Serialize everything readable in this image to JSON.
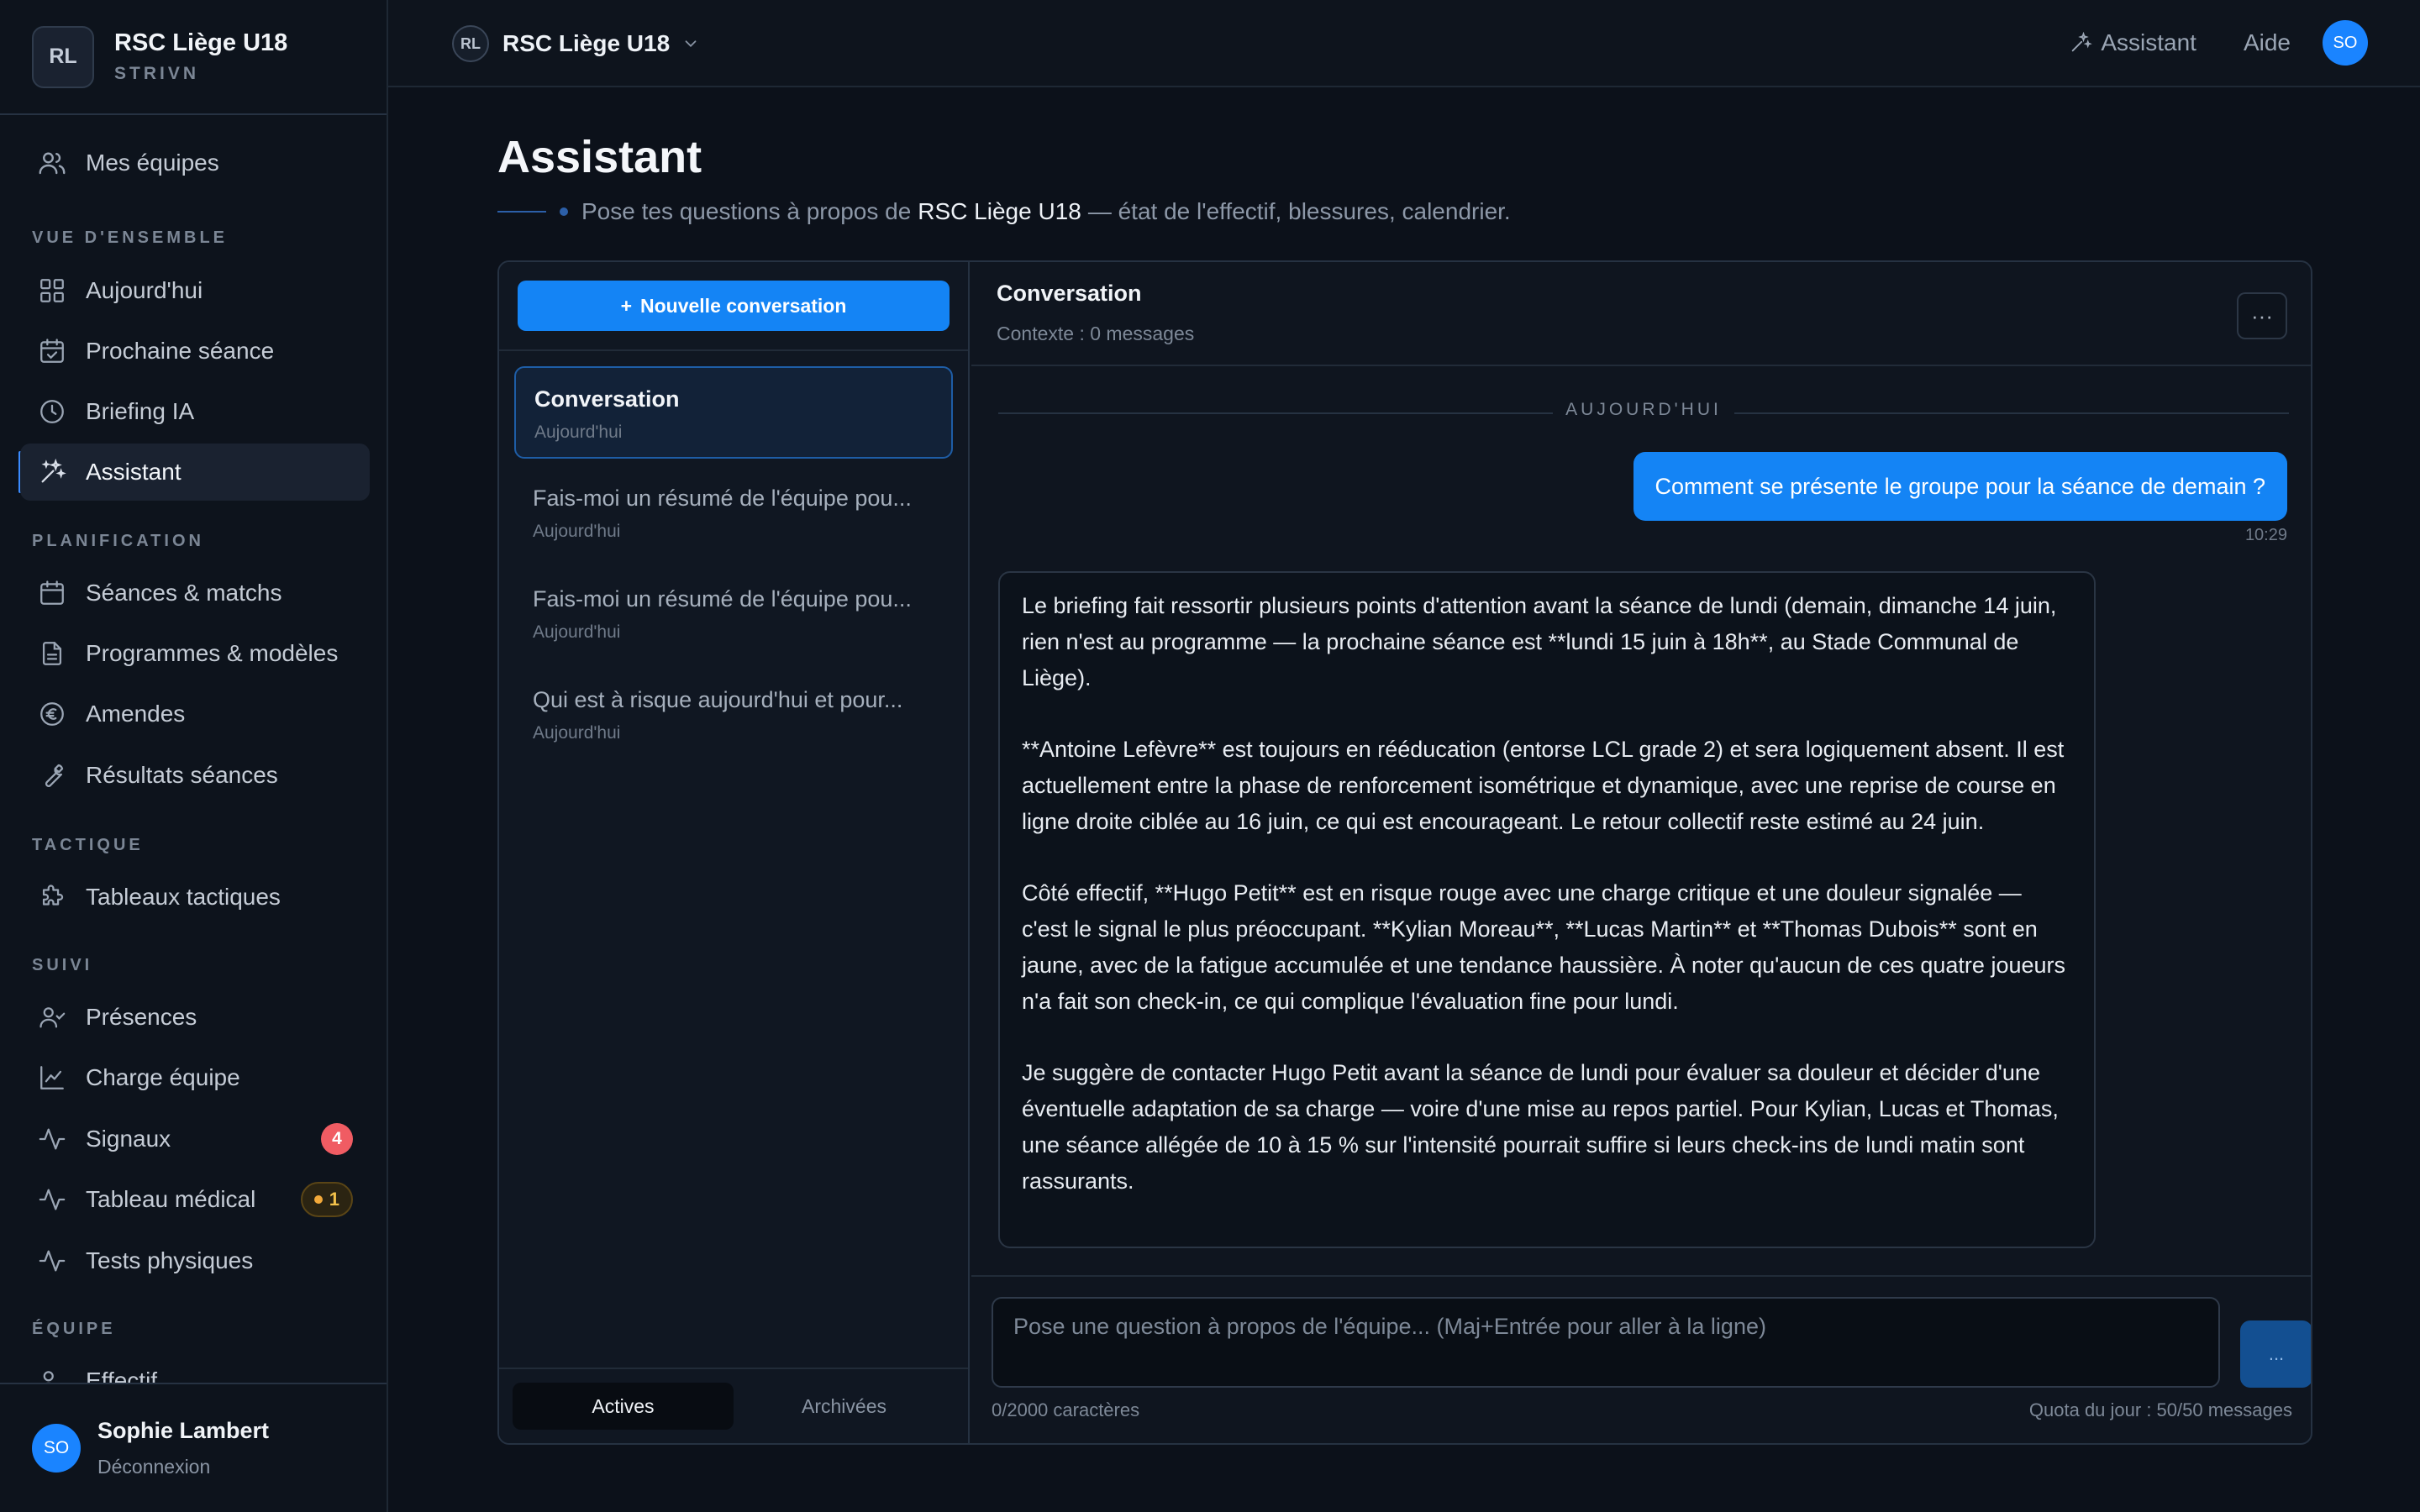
{
  "brand": {
    "initials": "RL",
    "name": "RSC Liège U18",
    "sub": "STRIVN"
  },
  "nav": {
    "my_teams": "Mes équipes",
    "sections": {
      "overview": "VUE D'ENSEMBLE",
      "planning": "PLANIFICATION",
      "tactics": "TACTIQUE",
      "tracking": "SUIVI",
      "team": "ÉQUIPE"
    },
    "items": {
      "today": "Aujourd'hui",
      "next_session": "Prochaine séance",
      "briefing": "Briefing IA",
      "assistant": "Assistant",
      "sessions": "Séances & matchs",
      "programs": "Programmes & modèles",
      "fines": "Amendes",
      "results": "Résultats séances",
      "boards": "Tableaux tactiques",
      "attendance": "Présences",
      "team_load": "Charge équipe",
      "signals": "Signaux",
      "medical": "Tableau médical",
      "physical_tests": "Tests physiques",
      "roster": "Effectif"
    },
    "badges": {
      "signals": "4",
      "medical": "1"
    }
  },
  "user": {
    "initials": "SO",
    "name": "Sophie Lambert",
    "logout": "Déconnexion"
  },
  "topbar": {
    "team_initials": "RL",
    "team_name": "RSC Liège U18",
    "assistant": "Assistant",
    "help": "Aide",
    "avatar": "SO"
  },
  "page": {
    "title": "Assistant",
    "subtitle_before": "Pose tes questions à propos de ",
    "subtitle_team": "RSC Liège U18",
    "subtitle_after": " — état de l'effectif, blessures, calendrier."
  },
  "conversations": {
    "new_button": "Nouvelle conversation",
    "new_icon": "+",
    "items": [
      {
        "title": "Conversation",
        "date": "Aujourd'hui"
      },
      {
        "title": "Fais-moi un résumé de l'équipe pou...",
        "date": "Aujourd'hui"
      },
      {
        "title": "Fais-moi un résumé de l'équipe pou...",
        "date": "Aujourd'hui"
      },
      {
        "title": "Qui est à risque aujourd'hui et pour...",
        "date": "Aujourd'hui"
      }
    ],
    "tabs": {
      "active": "Actives",
      "archived": "Archivées"
    }
  },
  "chat": {
    "title": "Conversation",
    "context": "Contexte : 0 messages",
    "more": "···",
    "day_separator": "AUJOURD'HUI",
    "user_message": "Comment se présente le groupe pour la séance de demain ?",
    "user_time": "10:29",
    "assistant_paragraphs": [
      "Le briefing fait ressortir plusieurs points d'attention avant la séance de lundi (demain, dimanche 14 juin, rien n'est au programme — la prochaine séance est **lundi 15 juin à 18h**, au Stade Communal de Liège).",
      "**Antoine Lefèvre** est toujours en rééducation (entorse LCL grade 2) et sera logiquement absent. Il est actuellement entre la phase de renforcement isométrique et dynamique, avec une reprise de course en ligne droite ciblée au 16 juin, ce qui est encourageant. Le retour collectif reste estimé au 24 juin.",
      "Côté effectif, **Hugo Petit** est en risque rouge avec une charge critique et une douleur signalée — c'est le signal le plus préoccupant. **Kylian Moreau**, **Lucas Martin** et **Thomas Dubois** sont en jaune, avec de la fatigue accumulée et une tendance haussière. À noter qu'aucun de ces quatre joueurs n'a fait son check-in, ce qui complique l'évaluation fine pour lundi.",
      "Je suggère de contacter Hugo Petit avant la séance de lundi pour évaluer sa douleur et décider d'une éventuelle adaptation de sa charge — voire d'une mise au repos partiel. Pour Kylian, Lucas et Thomas, une séance allégée de 10 à 15 % sur l'intensité pourrait suffire si leurs check-ins de lundi matin sont rassurants."
    ],
    "composer_placeholder": "Pose une question à propos de l'équipe... (Maj+Entrée pour aller à la ligne)",
    "send_label": "...",
    "char_count": "0/2000 caractères",
    "quota": "Quota du jour : 50/50 messages"
  },
  "colors": {
    "accent": "#1484f5",
    "danger": "#f05c63",
    "warning": "#f2c14a",
    "background": "#0c111a"
  }
}
